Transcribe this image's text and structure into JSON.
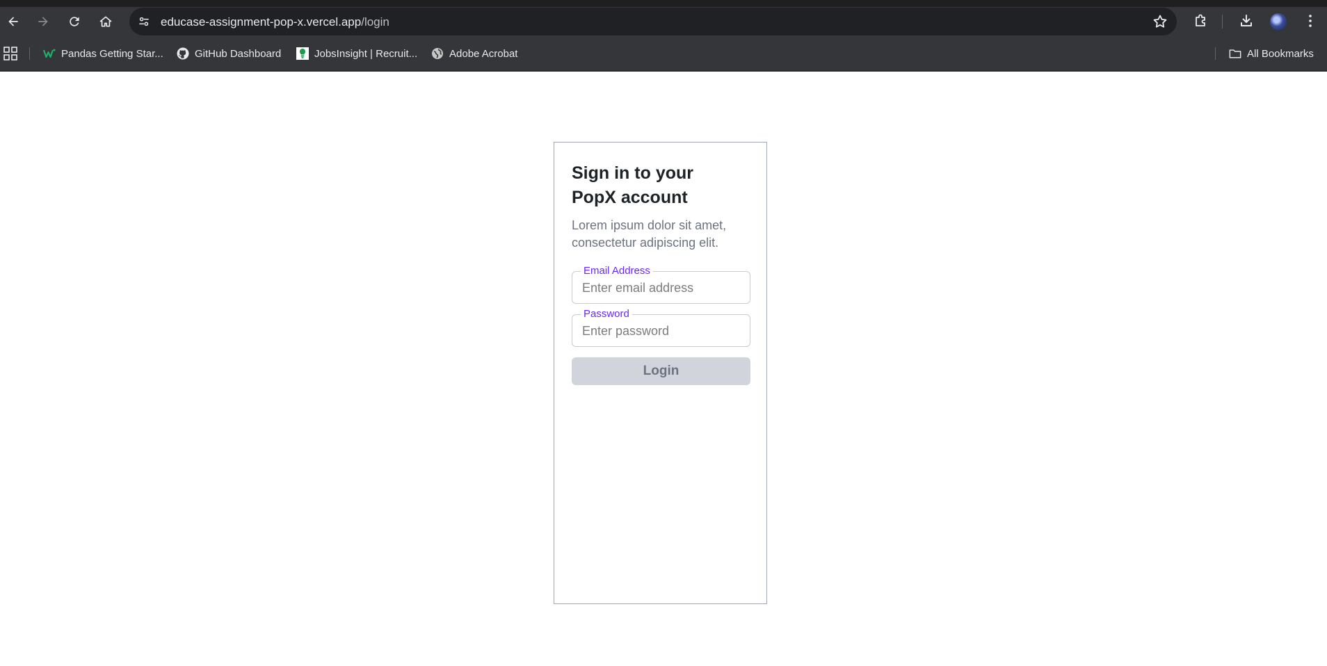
{
  "browser": {
    "url_host": "educase-assignment-pop-x.vercel.app",
    "url_path": "/login",
    "bookmarks": [
      {
        "label": "Pandas Getting Star...",
        "icon": "wordpress-like-icon"
      },
      {
        "label": "GitHub Dashboard",
        "icon": "github-icon"
      },
      {
        "label": "JobsInsight | Recruit...",
        "icon": "jobsinsight-icon"
      },
      {
        "label": "Adobe Acrobat",
        "icon": "globe-icon"
      }
    ],
    "all_bookmarks_label": "All Bookmarks"
  },
  "login": {
    "title": "Sign in to your PopX account",
    "subtitle": "Lorem ipsum dolor sit amet, consectetur adipiscing elit.",
    "email_label": "Email Address",
    "email_placeholder": "Enter email address",
    "email_value": "",
    "password_label": "Password",
    "password_placeholder": "Enter password",
    "password_value": "",
    "button_label": "Login"
  },
  "colors": {
    "accent": "#6c25ff",
    "button_disabled_bg": "#d1d5db",
    "chrome_bg": "#35363a"
  }
}
